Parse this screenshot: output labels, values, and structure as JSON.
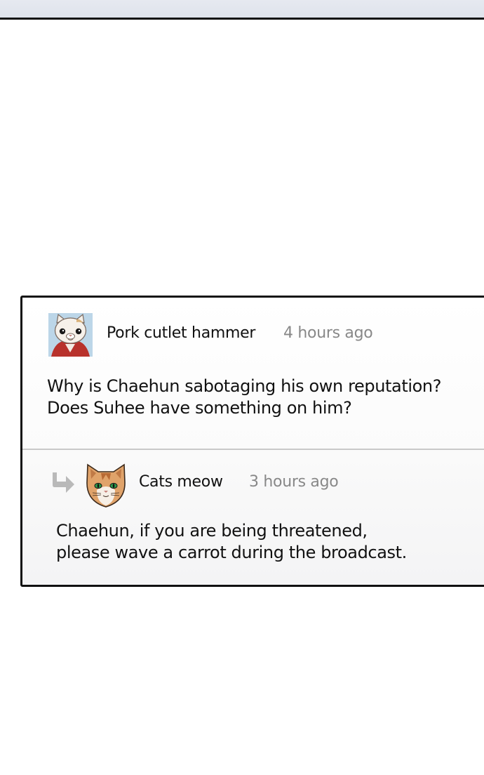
{
  "comments": [
    {
      "author": "Pork cutlet hammer",
      "time": "4 hours ago",
      "lines": [
        "Why is Chaehun sabotaging his own reputation?",
        "Does Suhee have something on him?"
      ],
      "avatar_icon": "white-cat-avatar-icon"
    }
  ],
  "reply": {
    "author": "Cats meow",
    "time": "3 hours ago",
    "lines": [
      "Chaehun, if you are being threatened,",
      "please wave a carrot during the broadcast."
    ],
    "avatar_icon": "orange-cat-avatar-icon",
    "indicator_icon": "reply-arrow-icon"
  },
  "colors": {
    "panel_border": "#111111",
    "divider": "#c9c9c9",
    "timestamp": "#888888",
    "top_bar": "#e2e6ee"
  }
}
